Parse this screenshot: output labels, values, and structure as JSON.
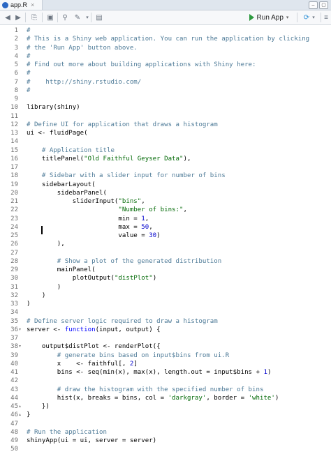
{
  "tab": {
    "filename": "app.R",
    "close": "×",
    "icon": "r-file-icon"
  },
  "toolbar": {
    "run_app_label": "Run App",
    "icons": [
      "back-icon",
      "forward-icon",
      "source-doc-icon",
      "save-icon",
      "search-icon",
      "magic-wand-icon",
      "compile-report-icon",
      "publish-icon",
      "outline-icon"
    ]
  },
  "window": {
    "buttons": [
      "minimize",
      "maximize"
    ]
  },
  "editor": {
    "lines": [
      {
        "n": "1",
        "t": "#",
        "c": "cm"
      },
      {
        "n": "2",
        "t": "# This is a Shiny web application. You can run the application by clicking",
        "c": "cm"
      },
      {
        "n": "3",
        "t": "# the 'Run App' button above.",
        "c": "cm"
      },
      {
        "n": "4",
        "t": "#",
        "c": "cm"
      },
      {
        "n": "5",
        "t": "# Find out more about building applications with Shiny here:",
        "c": "cm"
      },
      {
        "n": "6",
        "t": "#",
        "c": "cm"
      },
      {
        "n": "7",
        "t": "#    http://shiny.rstudio.com/",
        "c": "cm"
      },
      {
        "n": "8",
        "t": "#",
        "c": "cm"
      },
      {
        "n": "9",
        "t": ""
      },
      {
        "n": "10",
        "t": "library(shiny)"
      },
      {
        "n": "11",
        "t": ""
      },
      {
        "n": "12",
        "t": "# Define UI for application that draws a histogram",
        "c": "cm"
      },
      {
        "n": "13",
        "t": "ui <- fluidPage("
      },
      {
        "n": "14",
        "t": ""
      },
      {
        "n": "15",
        "t": "    # Application title",
        "c": "cm"
      },
      {
        "n": "16",
        "p": [
          [
            "    titlePanel(",
            ""
          ],
          [
            "\"Old Faithful Geyser Data\"",
            "st"
          ],
          [
            "),",
            ""
          ]
        ]
      },
      {
        "n": "17",
        "t": ""
      },
      {
        "n": "18",
        "t": "    # Sidebar with a slider input for number of bins",
        "c": "cm"
      },
      {
        "n": "19",
        "t": "    sidebarLayout("
      },
      {
        "n": "20",
        "t": "        sidebarPanel("
      },
      {
        "n": "21",
        "p": [
          [
            "            sliderInput(",
            ""
          ],
          [
            "\"bins\"",
            "st"
          ],
          [
            ",",
            ""
          ]
        ]
      },
      {
        "n": "22",
        "p": [
          [
            "                        ",
            ""
          ],
          [
            "\"Number of bins:\"",
            "st"
          ],
          [
            ",",
            ""
          ]
        ]
      },
      {
        "n": "23",
        "p": [
          [
            "                        min = ",
            ""
          ],
          [
            "1",
            "nu"
          ],
          [
            ",",
            ""
          ]
        ]
      },
      {
        "n": "24",
        "p": [
          [
            "                        max = ",
            ""
          ],
          [
            "50",
            "nu"
          ],
          [
            ",",
            ""
          ]
        ]
      },
      {
        "n": "25",
        "p": [
          [
            "                        value = ",
            ""
          ],
          [
            "30",
            "nu"
          ],
          [
            ")",
            ""
          ]
        ]
      },
      {
        "n": "26",
        "t": "        ),"
      },
      {
        "n": "27",
        "t": ""
      },
      {
        "n": "28",
        "t": "        # Show a plot of the generated distribution",
        "c": "cm"
      },
      {
        "n": "29",
        "t": "        mainPanel("
      },
      {
        "n": "30",
        "p": [
          [
            "            plotOutput(",
            ""
          ],
          [
            "\"distPlot\"",
            "st"
          ],
          [
            ")",
            ""
          ]
        ]
      },
      {
        "n": "31",
        "t": "        )"
      },
      {
        "n": "32",
        "t": "    )"
      },
      {
        "n": "33",
        "t": ")"
      },
      {
        "n": "34",
        "t": ""
      },
      {
        "n": "35",
        "t": "# Define server logic required to draw a histogram",
        "c": "cm"
      },
      {
        "n": "36",
        "f": "▾",
        "p": [
          [
            "server <- ",
            ""
          ],
          [
            "function",
            "kw"
          ],
          [
            "(input, output) {",
            ""
          ]
        ]
      },
      {
        "n": "37",
        "t": ""
      },
      {
        "n": "38",
        "f": "▾",
        "t": "    output$distPlot <- renderPlot({"
      },
      {
        "n": "39",
        "t": "        # generate bins based on input$bins from ui.R",
        "c": "cm"
      },
      {
        "n": "40",
        "p": [
          [
            "        x    <- faithful[, ",
            ""
          ],
          [
            "2",
            "nu"
          ],
          [
            "]",
            ""
          ]
        ]
      },
      {
        "n": "41",
        "p": [
          [
            "        bins <- seq(min(x), max(x), length.out = input$bins + ",
            ""
          ],
          [
            "1",
            "nu"
          ],
          [
            ")",
            ""
          ]
        ]
      },
      {
        "n": "42",
        "t": ""
      },
      {
        "n": "43",
        "t": "        # draw the histogram with the specified number of bins",
        "c": "cm"
      },
      {
        "n": "44",
        "p": [
          [
            "        hist(x, breaks = bins, col = ",
            ""
          ],
          [
            "'darkgray'",
            "st"
          ],
          [
            ", border = ",
            ""
          ],
          [
            "'white'",
            "st"
          ],
          [
            ")",
            ""
          ]
        ]
      },
      {
        "n": "45",
        "f": "▴",
        "t": "    })"
      },
      {
        "n": "46",
        "f": "▴",
        "t": "}"
      },
      {
        "n": "47",
        "t": ""
      },
      {
        "n": "48",
        "t": "# Run the application",
        "c": "cm"
      },
      {
        "n": "49",
        "t": "shinyApp(ui = ui, server = server)"
      },
      {
        "n": "50",
        "t": ""
      }
    ]
  }
}
